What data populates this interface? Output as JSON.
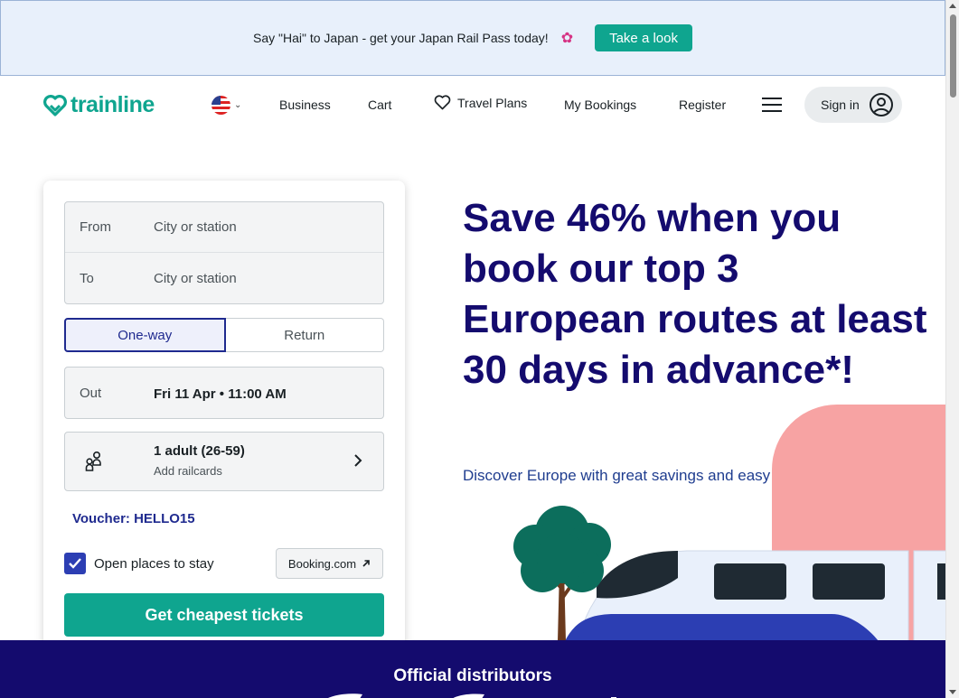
{
  "banner": {
    "text": "Say \"Hai\" to Japan - get your Japan Rail Pass today!",
    "flower_icon": "cherry-blossom",
    "button_label": "Take a look"
  },
  "header": {
    "logo_text": "trainline",
    "language_flag": "us-flag-icon",
    "nav": {
      "business": "Business",
      "cart": "Cart",
      "travel_plans": "Travel Plans",
      "my_bookings": "My Bookings",
      "register": "Register"
    },
    "signin_label": "Sign in"
  },
  "search": {
    "from_label": "From",
    "from_placeholder": "City or station",
    "to_label": "To",
    "to_placeholder": "City or station",
    "trip_types": {
      "one_way": "One-way",
      "return": "Return"
    },
    "selected_trip_type": "One-way",
    "out_label": "Out",
    "out_value": "Fri 11 Apr • 11:00 AM",
    "passengers": "1 adult (26-59)",
    "railcards": "Add railcards",
    "voucher": "Voucher: HELLO15",
    "stay_checked": true,
    "stay_label": "Open places to stay",
    "booking_link": "Booking.com",
    "cta": "Get cheapest tickets"
  },
  "hero": {
    "title": "Save 46% when you book our top 3 European routes at least 30 days in advance*!",
    "subtitle": "Discover Europe with great savings and easy booking"
  },
  "distributors": {
    "title": "Official distributors"
  },
  "colors": {
    "brand_green": "#0fa58f",
    "navy": "#140b6e",
    "banner_bg": "#e8f0fb",
    "link_blue": "#1f2a8f"
  }
}
